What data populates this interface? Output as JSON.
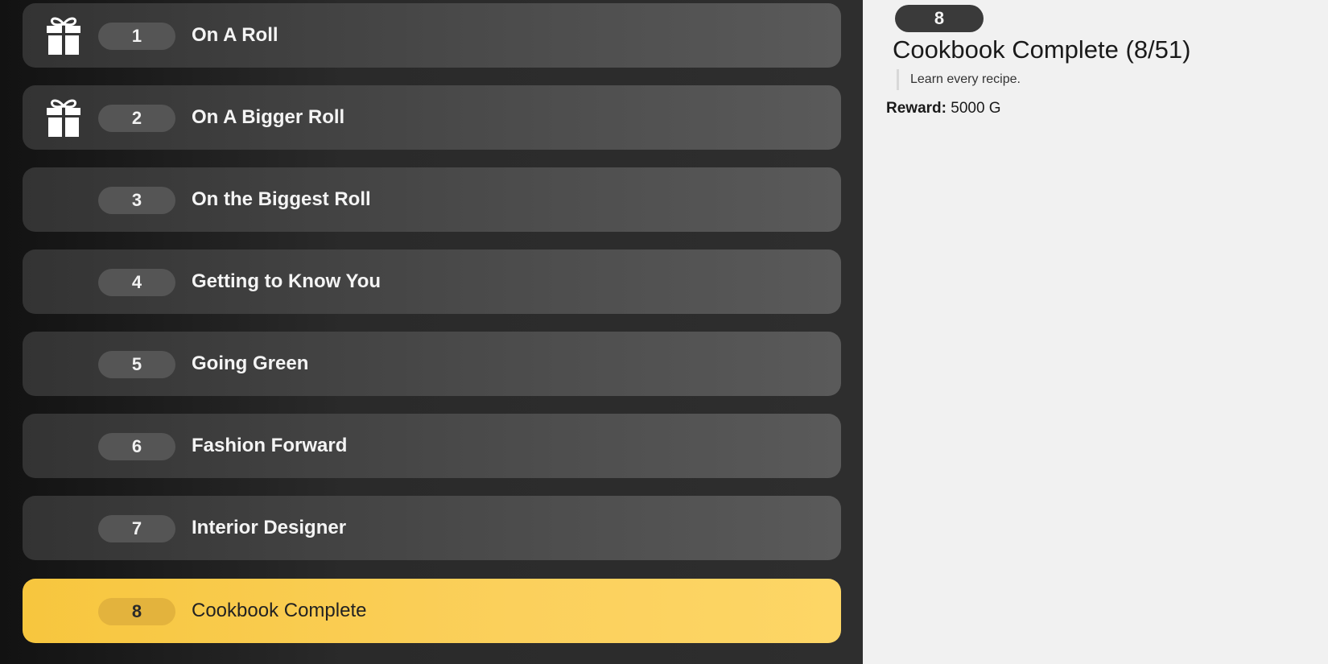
{
  "achievements": [
    {
      "number": "1",
      "label": "On A Roll",
      "gift_icon": "gift-icon",
      "has_gift": true
    },
    {
      "number": "2",
      "label": "On A Bigger Roll",
      "gift_icon": "gift-icon",
      "has_gift": true
    },
    {
      "number": "3",
      "label": "On the Biggest Roll",
      "has_gift": false
    },
    {
      "number": "4",
      "label": "Getting to Know You",
      "has_gift": false
    },
    {
      "number": "5",
      "label": "Going Green",
      "has_gift": false
    },
    {
      "number": "6",
      "label": "Fashion Forward",
      "has_gift": false
    },
    {
      "number": "7",
      "label": "Interior Designer",
      "has_gift": false
    },
    {
      "number": "8",
      "label": "Cookbook Complete",
      "has_gift": false,
      "selected": true
    }
  ],
  "detail": {
    "number": "8",
    "title": "Cookbook Complete (8/51)",
    "description": "Learn every recipe.",
    "reward_label": "Reward:",
    "reward_value": "5000 G"
  },
  "colors": {
    "selected_row": "#fbd05c",
    "row": "#4a4a4a",
    "detail_background": "#f1f1f1"
  }
}
